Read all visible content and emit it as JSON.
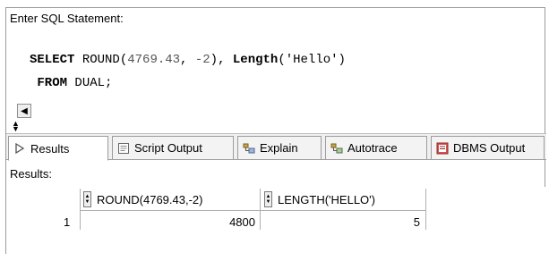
{
  "editor": {
    "label": "Enter SQL Statement:",
    "line1": {
      "kw1": "SELECT",
      "t1": " ROUND(",
      "n1": "4769.43",
      "t2": ", ",
      "n2": "-2",
      "t3": "), ",
      "kw2": "Length",
      "t4": "(",
      "s1": "'Hello'",
      "t5": ")"
    },
    "line2": {
      "kw1": "FROM",
      "t1": " DUAL;"
    }
  },
  "tabs": [
    {
      "label": "Results",
      "icon": "play-icon"
    },
    {
      "label": "Script Output",
      "icon": "script-icon"
    },
    {
      "label": "Explain",
      "icon": "explain-icon"
    },
    {
      "label": "Autotrace",
      "icon": "autotrace-icon"
    },
    {
      "label": "DBMS Output",
      "icon": "dbms-icon"
    }
  ],
  "results": {
    "label": "Results:",
    "columns": [
      "ROUND(4769.43,-2)",
      "LENGTH('HELLO')"
    ],
    "rows": [
      {
        "num": "1",
        "cells": [
          "4800",
          "5"
        ]
      }
    ]
  }
}
